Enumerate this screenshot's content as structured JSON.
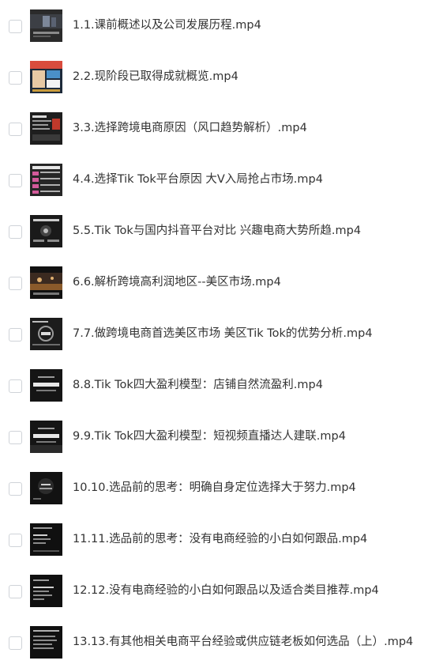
{
  "files": [
    {
      "name": "1.1.课前概述以及公司发展历程.mp4",
      "thumb_icon": "video-thumbnail-icon"
    },
    {
      "name": "2.2.现阶段已取得成就概览.mp4",
      "thumb_icon": "video-thumbnail-icon"
    },
    {
      "name": "3.3.选择跨境电商原因（风口趋势解析）.mp4",
      "thumb_icon": "video-thumbnail-icon"
    },
    {
      "name": "4.4.选择Tik Tok平台原因 大V入局抢占市场.mp4",
      "thumb_icon": "video-thumbnail-icon"
    },
    {
      "name": "5.5.Tik Tok与国内抖音平台对比 兴趣电商大势所趋.mp4",
      "thumb_icon": "video-thumbnail-icon"
    },
    {
      "name": "6.6.解析跨境高利润地区--美区市场.mp4",
      "thumb_icon": "video-thumbnail-icon"
    },
    {
      "name": "7.7.做跨境电商首选美区市场 美区Tik Tok的优势分析.mp4",
      "thumb_icon": "video-thumbnail-icon"
    },
    {
      "name": "8.8.Tik Tok四大盈利模型：店铺自然流盈利.mp4",
      "thumb_icon": "video-thumbnail-icon"
    },
    {
      "name": "9.9.Tik Tok四大盈利模型：短视频直播达人建联.mp4",
      "thumb_icon": "video-thumbnail-icon"
    },
    {
      "name": "10.10.选品前的思考：明确自身定位选择大于努力.mp4",
      "thumb_icon": "video-thumbnail-icon"
    },
    {
      "name": "11.11.选品前的思考：没有电商经验的小白如何跟品.mp4",
      "thumb_icon": "video-thumbnail-icon"
    },
    {
      "name": "12.12.没有电商经验的小白如何跟品以及适合类目推荐.mp4",
      "thumb_icon": "video-thumbnail-icon"
    },
    {
      "name": "13.13.有其他相关电商平台经验或供应链老板如何选品（上）.mp4",
      "thumb_icon": "video-thumbnail-icon"
    }
  ]
}
